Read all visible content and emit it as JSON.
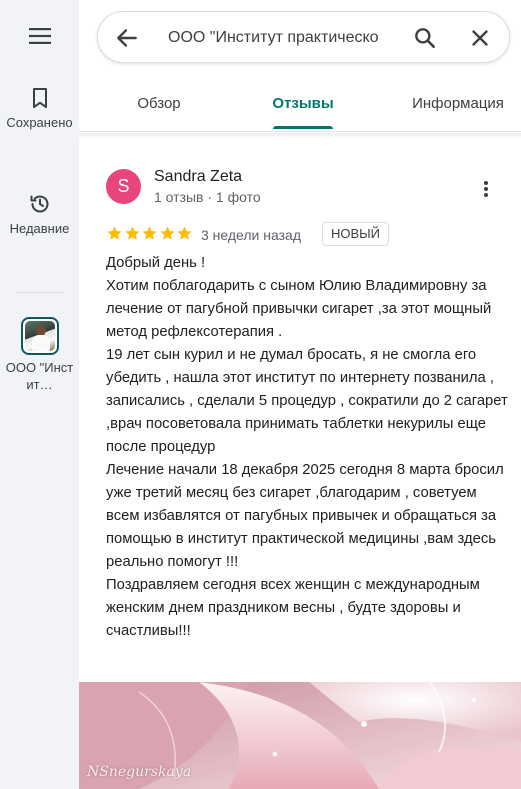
{
  "rail": {
    "items": [
      {
        "label": "Сохранено",
        "icon": "bookmark-icon"
      },
      {
        "label": "Недавние",
        "icon": "history-icon"
      },
      {
        "label": "ООО \"Инстит…",
        "icon": "place-thumbnail"
      }
    ]
  },
  "search": {
    "query": "ООО \"Институт практическо"
  },
  "tabs": [
    {
      "label": "Обзор",
      "active": false
    },
    {
      "label": "Отзывы",
      "active": true
    },
    {
      "label": "Информация",
      "active": false
    }
  ],
  "review": {
    "avatar_letter": "S",
    "avatar_color": "#e8457a",
    "author": "Sandra Zeta",
    "author_meta": "1 отзыв · 1 фото",
    "rating": 5,
    "when": "3 недели назад",
    "badge": "НОВЫЙ",
    "text": "Добрый день !\nХотим  поблагодарить  с сыном  Юлию Владимировну  за  лечение от пагубной привычки сигарет ,за этот мощный метод  рефлексотерапия .\n19 лет  сын курил  и не думал бросать, я  не смогла его убедить ,  нашла этот институт  по интернету позванила , записались  , сделали 5 процедур , сократили до 2 сагарет  ,врач посоветовала принимать таблетки некурилы  еще  после процедур\nЛечение начали 18 декабря 2025    сегодня 8 марта бросил  уже третий месяц без сигарет ,благодарим , советуем  всем  избавлятся  от пагубных привычек  и обращаться  за помощью  в институт практической медицины  ,вам здесь  реально помогут !!!\nПоздравляем сегодня всех женщин с международным женским днем  праздником весны , будте здоровы и счастливы!!!"
  },
  "photo": {
    "signature": "NSnegurskaya"
  },
  "colors": {
    "accent": "#00796b",
    "star": "#fbbc04",
    "rail_bg": "#f1f3f6"
  }
}
